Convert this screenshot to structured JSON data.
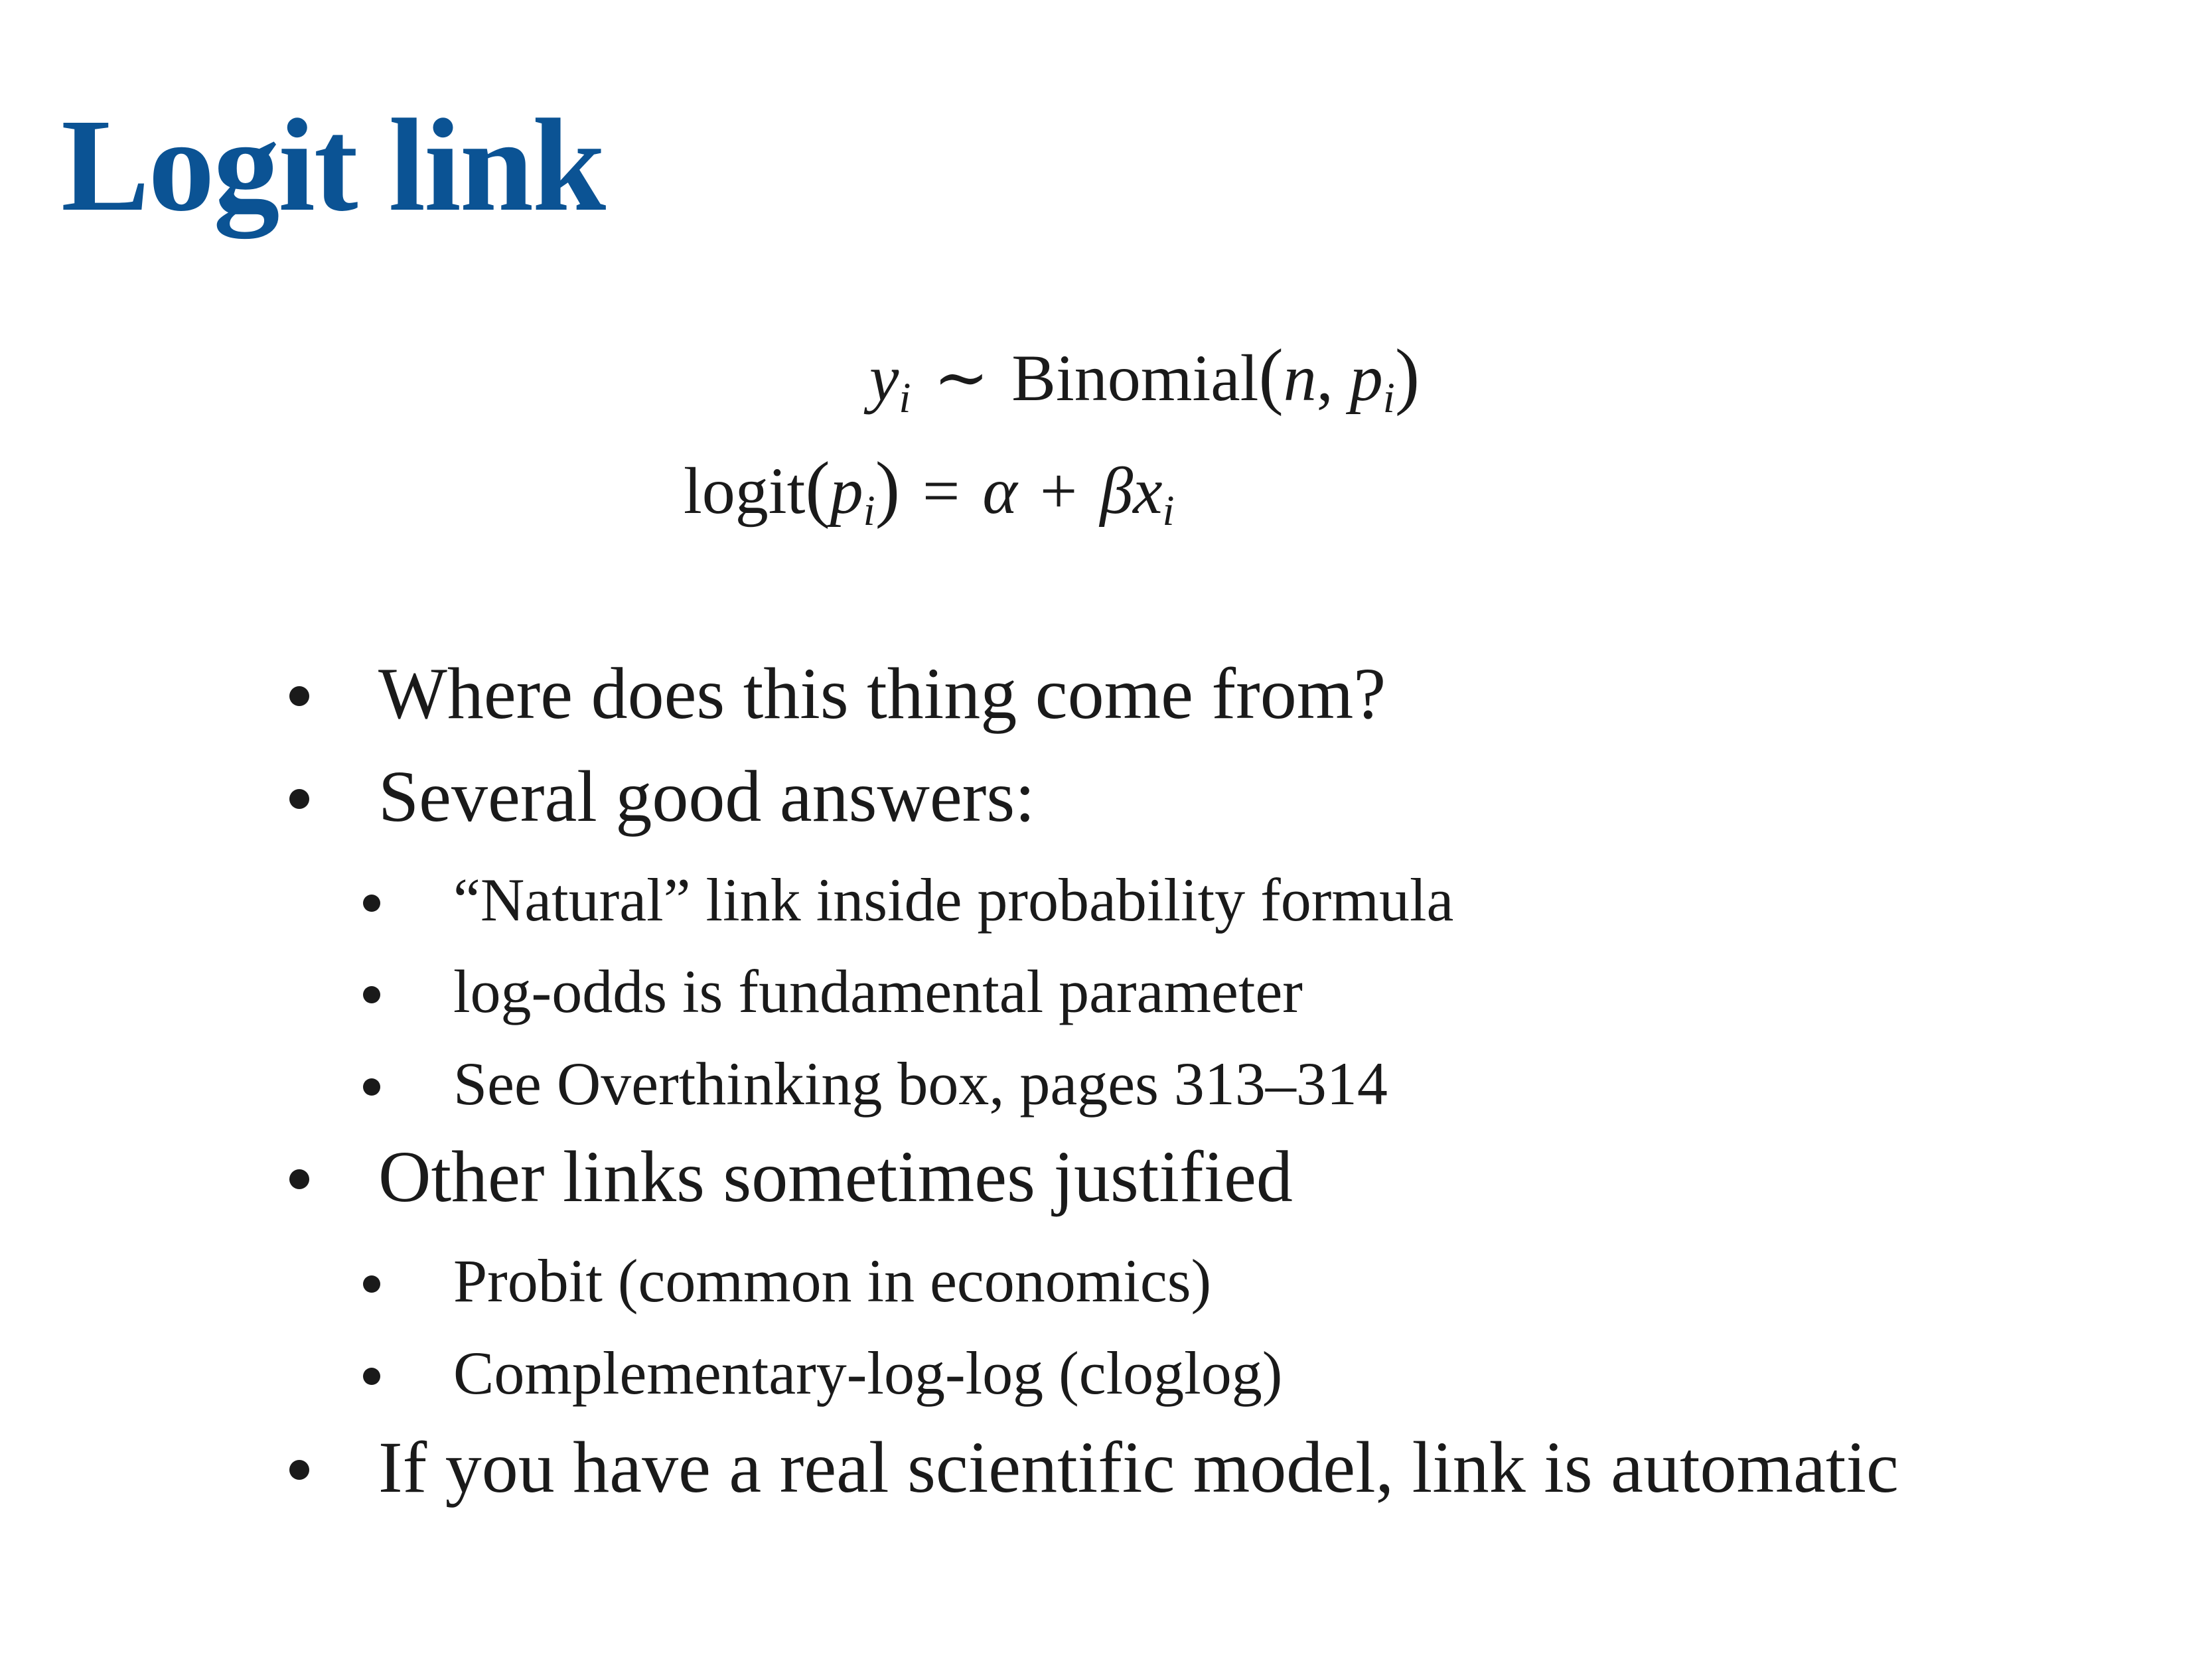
{
  "slide": {
    "title": "Logit link",
    "title_color": "#0b5394"
  },
  "equations": {
    "eq1": {
      "lhs_var": "y",
      "lhs_sub": "i",
      "relation": "∼",
      "dist_name": "Binomial",
      "open_paren": "(",
      "arg1": "n",
      "comma": ", ",
      "arg2": "p",
      "arg2_sub": "i",
      "close_paren": ")"
    },
    "eq2": {
      "func": "logit",
      "open_paren": "(",
      "arg": "p",
      "arg_sub": "i",
      "close_paren": ")",
      "equals": "=",
      "alpha": "α",
      "plus": "+",
      "beta": "β",
      "x": "x",
      "x_sub": "i"
    }
  },
  "bullets": {
    "b1": "Where does this thing come from?",
    "b2": "Several good answers:",
    "b3": "“Natural” link inside probability formula",
    "b4": "log-odds is fundamental parameter",
    "b5": "See Overthinking box, pages 313–314",
    "b6": "Other links sometimes justified",
    "b7": "Probit (common in economics)",
    "b8": "Complementary-log-log (cloglog)",
    "b9": "If you have a real scientific model, link is automatic"
  }
}
